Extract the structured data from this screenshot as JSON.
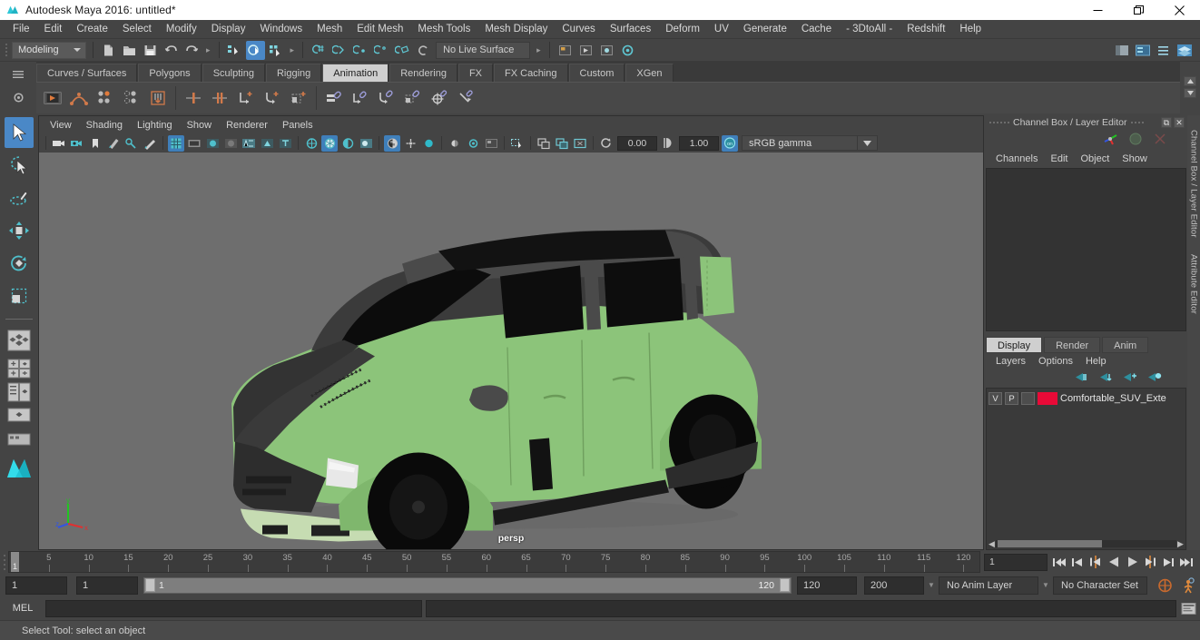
{
  "window": {
    "title": "Autodesk Maya 2016: untitled*",
    "minimize": "—",
    "maximize": "❐",
    "close": "✕"
  },
  "menubar": {
    "items": [
      {
        "label": "File"
      },
      {
        "label": "Edit"
      },
      {
        "label": "Create"
      },
      {
        "label": "Select"
      },
      {
        "label": "Modify"
      },
      {
        "label": "Display"
      },
      {
        "label": "Windows"
      },
      {
        "label": "Mesh"
      },
      {
        "label": "Edit Mesh"
      },
      {
        "label": "Mesh Tools"
      },
      {
        "label": "Mesh Display"
      },
      {
        "label": "Curves"
      },
      {
        "label": "Surfaces"
      },
      {
        "label": "Deform"
      },
      {
        "label": "UV"
      },
      {
        "label": "Generate"
      },
      {
        "label": "Cache"
      },
      {
        "label": "- 3DtoAll -"
      },
      {
        "label": "Redshift"
      },
      {
        "label": "Help"
      }
    ]
  },
  "statusline": {
    "mode": "Modeling",
    "live_surface": "No Live Surface"
  },
  "shelf": {
    "tabs": [
      {
        "label": "Curves / Surfaces",
        "active": false
      },
      {
        "label": "Polygons",
        "active": false
      },
      {
        "label": "Sculpting",
        "active": false
      },
      {
        "label": "Rigging",
        "active": false
      },
      {
        "label": "Animation",
        "active": true
      },
      {
        "label": "Rendering",
        "active": false
      },
      {
        "label": "FX",
        "active": false
      },
      {
        "label": "FX Caching",
        "active": false
      },
      {
        "label": "Custom",
        "active": false
      },
      {
        "label": "XGen",
        "active": false
      }
    ]
  },
  "viewport": {
    "menus": [
      {
        "label": "View"
      },
      {
        "label": "Shading"
      },
      {
        "label": "Lighting"
      },
      {
        "label": "Show"
      },
      {
        "label": "Renderer"
      },
      {
        "label": "Panels"
      }
    ],
    "exposure": "0.00",
    "gamma_value": "1.00",
    "color_space": "sRGB gamma",
    "camera_label": "persp",
    "axis_x": "x",
    "axis_y": "y",
    "axis_z": "z",
    "bg_color": "#6e6e6e",
    "body_color": "#8cc47a",
    "dark_color": "#3b3b3b"
  },
  "channelbox": {
    "title": "Channel Box / Layer Editor",
    "menus": [
      {
        "label": "Channels"
      },
      {
        "label": "Edit"
      },
      {
        "label": "Object"
      },
      {
        "label": "Show"
      }
    ],
    "side_tabs": [
      "Channel Box / Layer Editor",
      "Attribute Editor"
    ]
  },
  "layers": {
    "tabs": [
      {
        "label": "Display",
        "active": true
      },
      {
        "label": "Render",
        "active": false
      },
      {
        "label": "Anim",
        "active": false
      }
    ],
    "menus": [
      {
        "label": "Layers"
      },
      {
        "label": "Options"
      },
      {
        "label": "Help"
      }
    ],
    "rows": [
      {
        "visibility": "V",
        "playback": "P",
        "state": "",
        "color": "#e80a37",
        "name": "Comfortable_SUV_Exte"
      }
    ]
  },
  "timeline": {
    "ticks": [
      5,
      10,
      15,
      20,
      25,
      30,
      35,
      40,
      45,
      50,
      55,
      60,
      65,
      70,
      75,
      80,
      85,
      90,
      95,
      100,
      105,
      110,
      115,
      120
    ],
    "current_frame_marker": "1",
    "current_frame_field": "1",
    "range_start": "1",
    "anim_start": "1",
    "playback_start": "1",
    "playback_end": "120",
    "range_end": "120",
    "anim_end": "200",
    "anim_layer": "No Anim Layer",
    "character_set": "No Character Set"
  },
  "commandline": {
    "label": "MEL",
    "input_value": "",
    "output_value": ""
  },
  "helpline": {
    "text": "Select Tool: select an object"
  }
}
